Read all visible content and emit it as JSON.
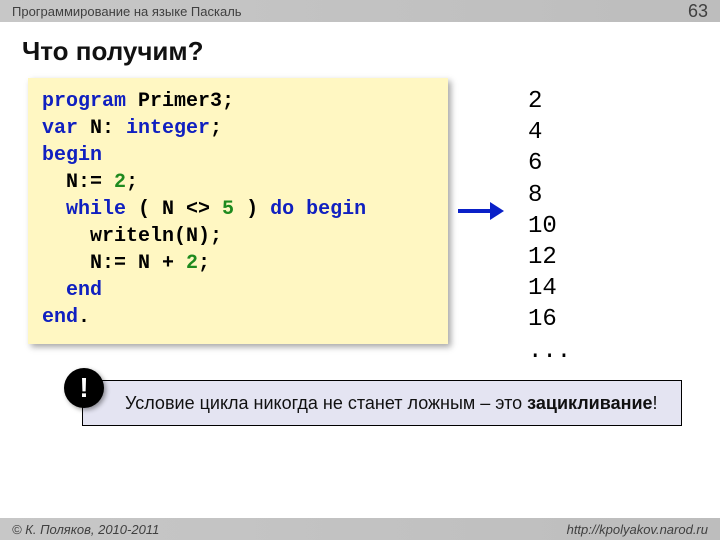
{
  "header": {
    "course": "Программирование на языке Паскаль",
    "page_num": "63"
  },
  "title": "Что получим?",
  "code": {
    "l1_kw": "program",
    "l1_rest": " Primer3;",
    "l2_kw": "var",
    "l2_mid": " N: ",
    "l2_type": "integer",
    "l2_end": ";",
    "l3_kw": "begin",
    "l4_pre": "  N:= ",
    "l4_num": "2",
    "l4_end": ";",
    "l5_pre": "  ",
    "l5_kw1": "while",
    "l5_mid1": " ( N <> ",
    "l5_num": "5",
    "l5_mid2": " ) ",
    "l5_kw2": "do begin",
    "l6": "    writeln(N);",
    "l7_pre": "    N:= N + ",
    "l7_num": "2",
    "l7_end": ";",
    "l8_pre": "  ",
    "l8_kw": "end",
    "l9_kw": "end",
    "l9_end": "."
  },
  "output_text": "2\n4\n6\n8\n10\n12\n14\n16\n...",
  "note": {
    "bang": "!",
    "text1": "Условие цикла никогда не станет ложным – это ",
    "text2": "зацикливание",
    "text3": "!"
  },
  "footer": {
    "copyright": "© К. Поляков, 2010-2011",
    "url": "http://kpolyakov.narod.ru"
  }
}
